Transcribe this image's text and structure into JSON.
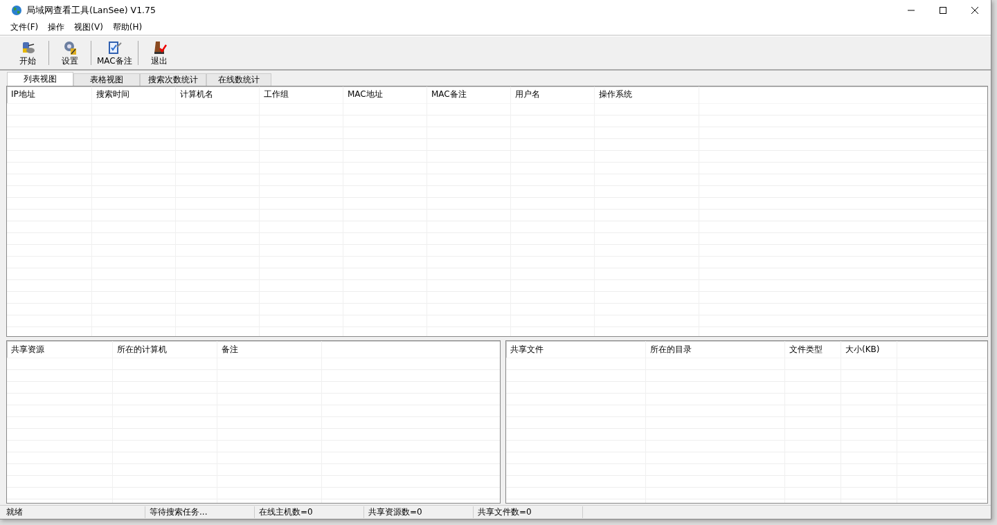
{
  "window": {
    "title": "局域网查看工具(LanSee) V1.75"
  },
  "menu": [
    "文件(F)",
    "操作",
    "视图(V)",
    "帮助(H)"
  ],
  "toolbar": [
    {
      "label": "开始",
      "kind": "start"
    },
    {
      "label": "设置",
      "kind": "settings"
    },
    {
      "label": "MAC备注",
      "kind": "note"
    },
    {
      "label": "退出",
      "kind": "exit"
    }
  ],
  "tabs": [
    {
      "label": "列表视图",
      "selected": true
    },
    {
      "label": "表格视图",
      "selected": false
    },
    {
      "label": "搜索次数统计",
      "selected": false
    },
    {
      "label": "在线数统计",
      "selected": false
    }
  ],
  "hosts_table": {
    "columns": [
      "IP地址",
      "搜索时间",
      "计算机名",
      "工作组",
      "MAC地址",
      "MAC备注",
      "用户名",
      "操作系统"
    ]
  },
  "shares_table": {
    "columns": [
      "共享资源",
      "所在的计算机",
      "备注"
    ]
  },
  "files_table": {
    "columns": [
      "共享文件",
      "所在的目录",
      "文件类型",
      "大小(KB)"
    ]
  },
  "status_bar": [
    "就绪",
    "等待搜索任务...",
    "在线主机数=0",
    "共享资源数=0",
    "共享文件数=0"
  ]
}
